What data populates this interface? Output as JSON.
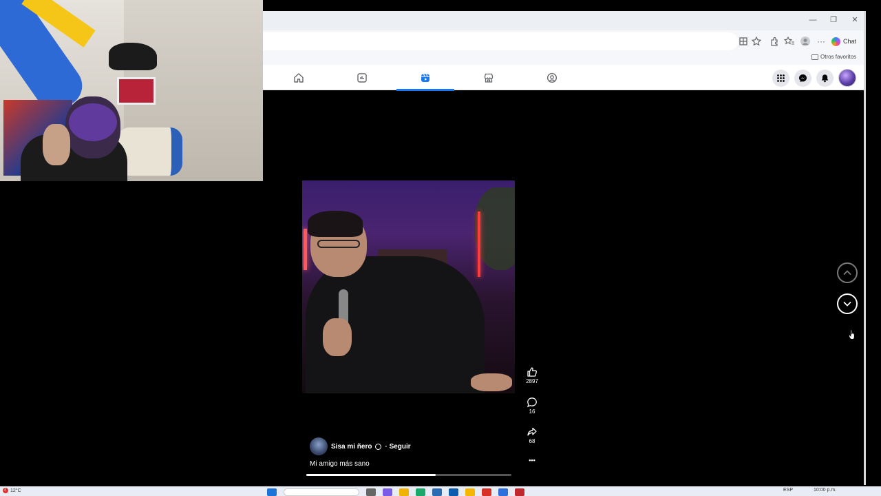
{
  "browser": {
    "window_controls": {
      "minimize": "—",
      "restore": "❐",
      "close": "✕"
    },
    "toolbar": {
      "icons": [
        "app-icon",
        "star-icon",
        "extensions-icon",
        "favorites-icon",
        "profile-icon",
        "more-icon"
      ],
      "more_label": "···",
      "chat_label": "Chat"
    },
    "favorites_bar": {
      "other_favorites": "Otros favoritos"
    }
  },
  "facebook": {
    "nav_tabs": [
      {
        "name": "home",
        "icon": "home-icon",
        "active": false
      },
      {
        "name": "watch",
        "icon": "video-icon",
        "active": false
      },
      {
        "name": "reels",
        "icon": "reels-icon",
        "active": true
      },
      {
        "name": "marketplace",
        "icon": "marketplace-icon",
        "active": false
      },
      {
        "name": "groups",
        "icon": "groups-icon",
        "active": false
      }
    ],
    "right_icons": [
      "menu-grid-icon",
      "messenger-icon",
      "notifications-icon",
      "profile-avatar"
    ]
  },
  "reel": {
    "likes": "2897",
    "comments": "16",
    "shares": "68",
    "more_label": "•••",
    "author_name": "Sisa mi ñero",
    "follow_label": "· Seguir",
    "caption": "Mi amigo más sano",
    "progress": 0.63
  },
  "taskbar": {
    "temperature": "12°C",
    "notification_count": "2",
    "language": "ESP",
    "time": "10:00 p.m."
  },
  "colors": {
    "facebook_blue": "#1877f2",
    "background": "#000000"
  }
}
